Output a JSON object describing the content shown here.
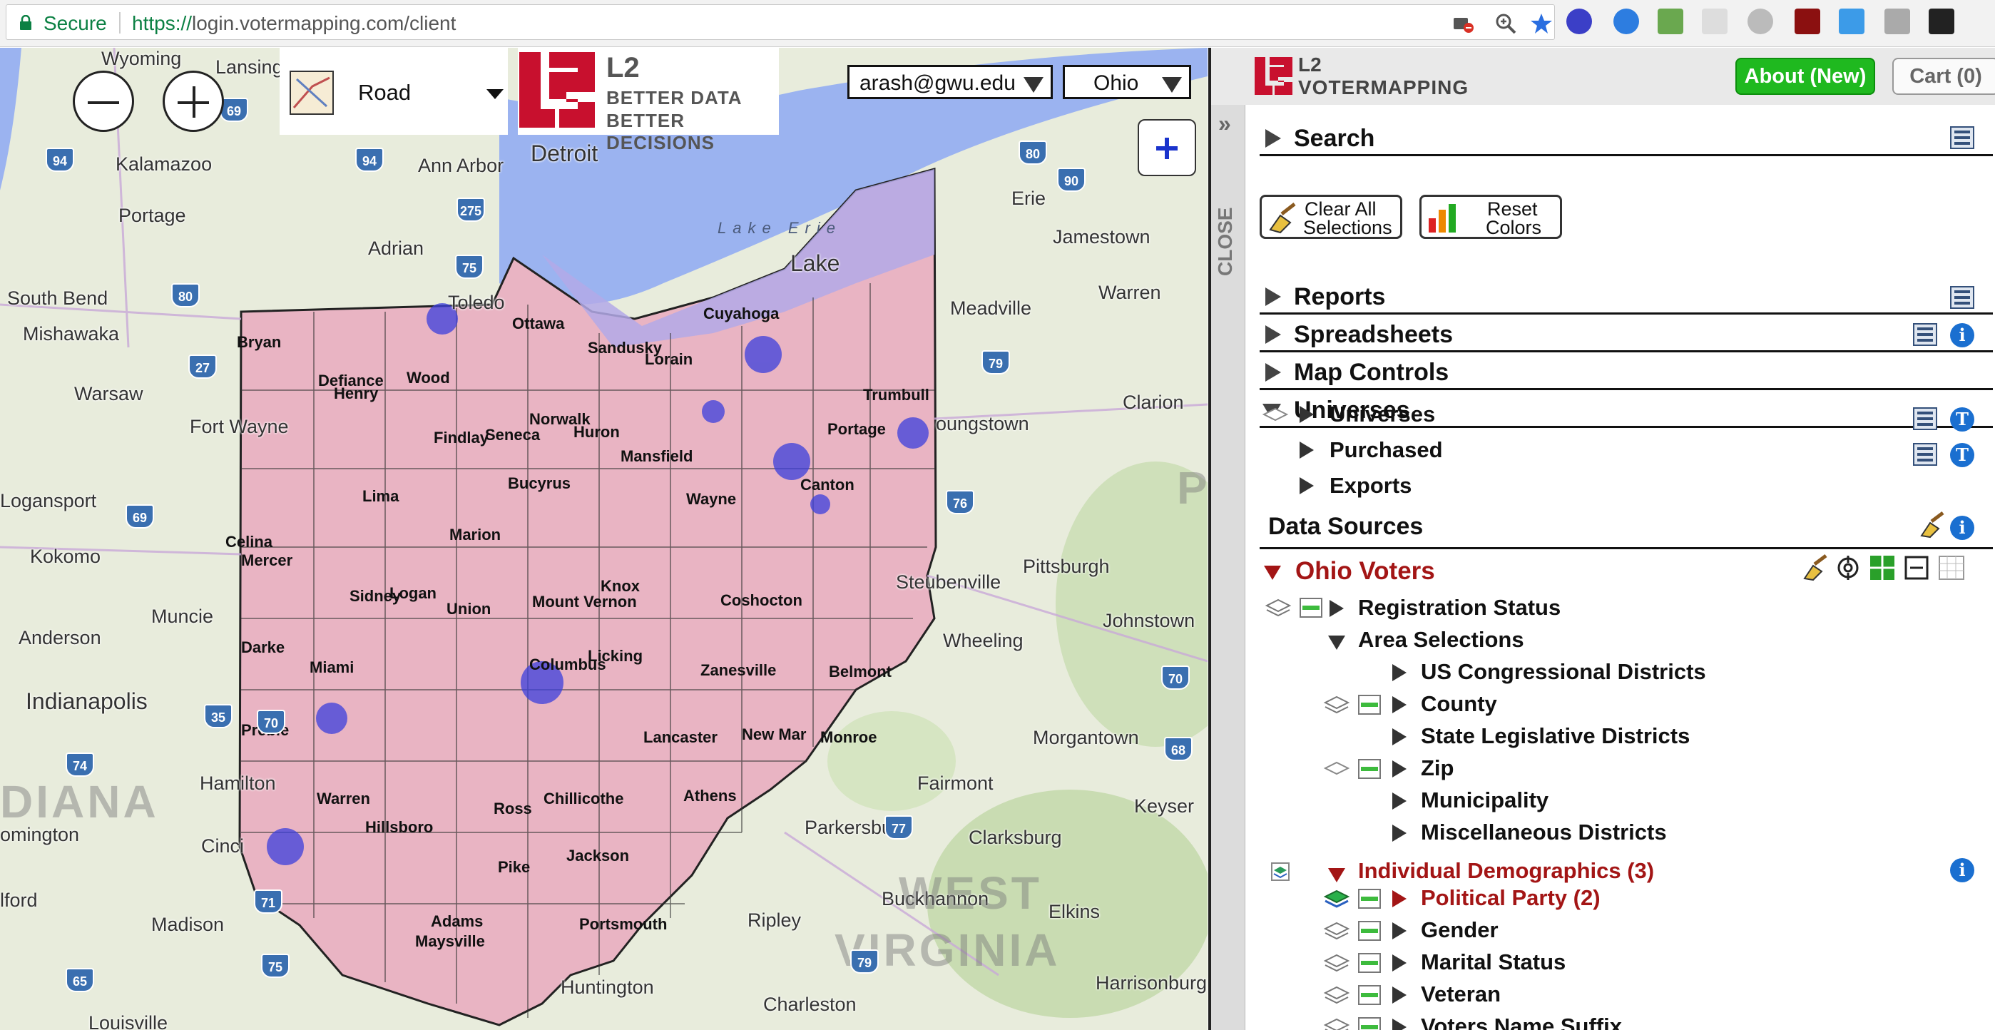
{
  "browser": {
    "secure_label": "Secure",
    "url_scheme": "https://",
    "url_rest": "login.votermapping.com/client"
  },
  "map": {
    "map_type": "Road",
    "account": "arash@gwu.edu",
    "state": "Ohio",
    "logo": {
      "top": "L2",
      "line1": "BETTER DATA",
      "line2": "BETTER DECISIONS"
    },
    "labels": {
      "wyoming": "Wyoming",
      "lansing": "Lansing",
      "kalamazoo": "Kalamazoo",
      "portage": "Portage",
      "ann_arbor": "Ann Arbor",
      "detroit": "Detroit",
      "adrian": "Adrian",
      "toledo": "Toledo",
      "south_bend": "South Bend",
      "mishawaka": "Mishawaka",
      "warsaw": "Warsaw",
      "fort_wayne": "Fort Wayne",
      "logansport": "Logansport",
      "kokomo": "Kokomo",
      "anderson": "Anderson",
      "muncie": "Muncie",
      "indianapolis": "Indianapolis",
      "hamilton": "Hamilton",
      "bloomington": "omington",
      "cinci": "Cinci",
      "madison": "Madison",
      "louisville": "Louisville",
      "ilford": "lford",
      "diana": "DIANA",
      "erie": "Erie",
      "jamestown": "Jamestown",
      "warren": "Warren",
      "meadville": "Meadville",
      "clarion": "Clarion",
      "youngstown": "oungstown",
      "pittsburgh": "Pittsburgh",
      "johnstown": "Johnstown",
      "steubenville": "Steubenville",
      "wheeling": "Wheeling",
      "morgantown": "Morgantown",
      "fairmont": "Fairmont",
      "keyser": "Keyser",
      "clarksburg": "Clarksburg",
      "parkersburg": "Parkersburg",
      "buckhannon": "Buckhannon",
      "elkins": "Elkins",
      "ripley": "Ripley",
      "charleston": "Charleston",
      "huntington": "Huntington",
      "harrisonburg": "Harrisonburg",
      "west": "WEST",
      "virginia": "VIRGINIA",
      "pa": "P",
      "lake_erie": "Lake Erie",
      "lake": "Lake",
      "bryan": "Bryan",
      "defiance": "Defiance",
      "henry": "Henry",
      "wood": "Wood",
      "ottawa": "Ottawa",
      "sandusky": "Sandusky",
      "lorain": "Lorain",
      "cuyahoga": "Cuyahoga",
      "trumbull": "Trumbull",
      "portage_c": "Portage",
      "norwalk": "Norwalk",
      "huron": "Huron",
      "findlay": "Findlay",
      "seneca": "Seneca",
      "bucyrus": "Bucyrus",
      "mansfield": "Mansfield",
      "wayne": "Wayne",
      "canton": "Canton",
      "lima": "Lima",
      "celina": "Celina",
      "mercer": "Mercer",
      "marion": "Marion",
      "sidney": "Sidney",
      "logan": "Logan",
      "union": "Union",
      "mount_vernon": "Mount Vernon",
      "knox": "Knox",
      "coshocton": "Coshocton",
      "darke": "Darke",
      "miami": "Miami",
      "licking": "Licking",
      "zanesville": "Zanesville",
      "belmont": "Belmont",
      "columbus": "Columbus",
      "preble": "Preble",
      "warren_c": "Warren",
      "lancaster": "Lancaster",
      "new_martinsville": "New Mar",
      "monroe": "Monroe",
      "chillicothe": "Chillicothe",
      "athens": "Athens",
      "hillsboro": "Hillsboro",
      "ross": "Ross",
      "pike": "Pike",
      "jackson": "Jackson",
      "adams": "Adams",
      "maysville": "Maysville",
      "portsmouth": "Portsmouth"
    },
    "shields": [
      "69",
      "94",
      "94",
      "275",
      "75",
      "80",
      "80",
      "27",
      "69",
      "35",
      "70",
      "74",
      "71",
      "75",
      "65",
      "90",
      "79",
      "76",
      "70",
      "79",
      "68",
      "77"
    ]
  },
  "panel": {
    "logo_l2": "L2",
    "logo_vm": "VOTERMAPPING",
    "about_button": "About (New)",
    "cart_button": "Cart (0)",
    "close_label": "CLOSE",
    "sections": {
      "search": "Search",
      "reports": "Reports",
      "spreadsheets": "Spreadsheets",
      "map_controls": "Map Controls",
      "universes": "Universes"
    },
    "clear_button": {
      "line1": "Clear All",
      "line2": "Selections"
    },
    "reset_button": {
      "line1": "Reset",
      "line2": "Colors"
    },
    "universes_items": [
      "Universes",
      "Purchased",
      "Exports"
    ],
    "data_sources_label": "Data Sources",
    "ohio_voters_label": "Ohio Voters",
    "tree": {
      "registration_status": "Registration Status",
      "area_selections": "Area Selections",
      "us_congressional": "US Congressional Districts",
      "county": "County",
      "state_legislative": "State Legislative Districts",
      "zip": "Zip",
      "municipality": "Municipality",
      "misc_districts": "Miscellaneous Districts",
      "individual_demographics": "Individual Demographics  (3)",
      "political_party": "Political Party  (2)",
      "gender": "Gender",
      "marital_status": "Marital Status",
      "veteran": "Veteran",
      "voters_name_suffix": "Voters Name Suffix"
    },
    "colors": {
      "accent_red": "#a31515",
      "about_green": "#1fb91f",
      "info_blue": "#1a6fd0"
    }
  }
}
